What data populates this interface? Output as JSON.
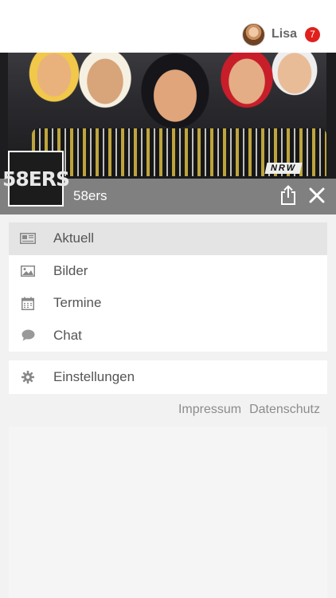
{
  "header": {
    "user_name": "Lisa",
    "notification_count": "7",
    "badge_color": "#e0201d"
  },
  "banner": {
    "logo_text": "58ERS",
    "club_name": "58ers",
    "photo_text": "NRW",
    "share_icon": "share-icon",
    "close_icon": "close-icon"
  },
  "menu": {
    "items": [
      {
        "label": "Aktuell",
        "icon": "newspaper-icon",
        "active": true
      },
      {
        "label": "Bilder",
        "icon": "image-icon",
        "active": false
      },
      {
        "label": "Termine",
        "icon": "calendar-icon",
        "active": false
      },
      {
        "label": "Chat",
        "icon": "chat-bubble-icon",
        "active": false
      }
    ],
    "settings": {
      "label": "Einstellungen",
      "icon": "gear-icon"
    }
  },
  "footer": {
    "impressum": "Impressum",
    "datenschutz": "Datenschutz"
  }
}
